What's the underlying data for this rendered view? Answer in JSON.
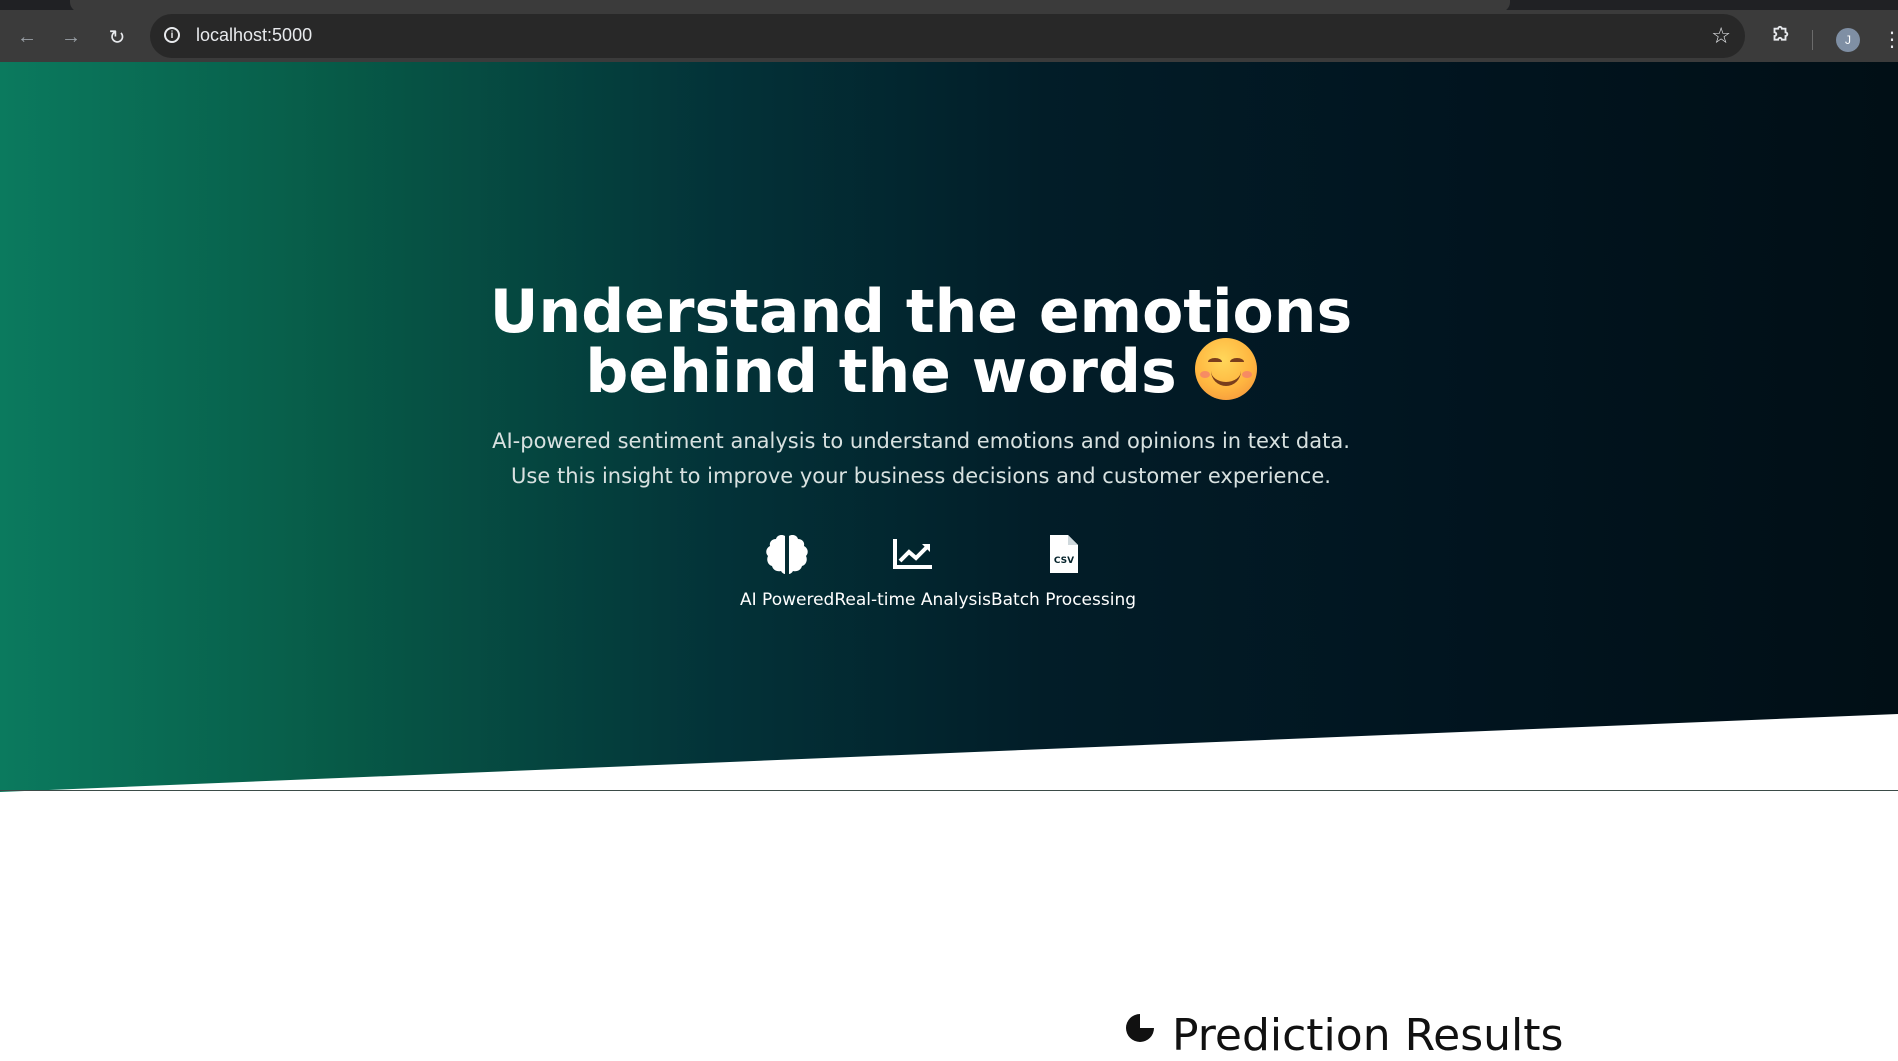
{
  "browser": {
    "url": "localhost:5000",
    "avatar_initial": "J"
  },
  "hero": {
    "title_line1": "Understand the emotions",
    "title_line2": "behind the words",
    "subtitle": "AI-powered sentiment analysis to understand emotions and opinions in text data. Use this insight to improve your business decisions and customer experience.",
    "features": [
      {
        "label": "AI Powered",
        "icon": "brain-icon"
      },
      {
        "label": "Real-time Analysis",
        "icon": "chart-line-icon"
      },
      {
        "label": "Batch Processing",
        "icon": "csv-file-icon"
      }
    ],
    "gradient_colors": [
      "#0b7a5e",
      "#033238",
      "#010f16"
    ]
  },
  "results": {
    "heading": "Prediction Results"
  }
}
